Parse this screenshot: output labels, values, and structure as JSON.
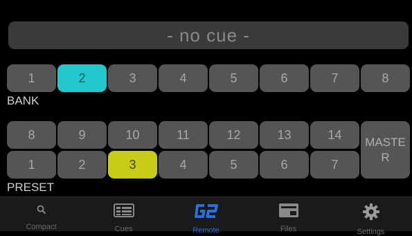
{
  "cue_display": {
    "text": "- no cue -"
  },
  "bank": {
    "label": "BANK",
    "buttons": [
      "1",
      "2",
      "3",
      "4",
      "5",
      "6",
      "7",
      "8"
    ],
    "selected": "2"
  },
  "preset": {
    "label": "PRESET",
    "row1": [
      "8",
      "9",
      "10",
      "11",
      "12",
      "13",
      "14"
    ],
    "row2": [
      "1",
      "2",
      "3",
      "4",
      "5",
      "6",
      "7"
    ],
    "selected": "3",
    "master_label": "MASTER"
  },
  "tabbar": {
    "tabs": [
      {
        "label": "Compact",
        "icon": "search-icon"
      },
      {
        "label": "Cues",
        "icon": "cues-icon"
      },
      {
        "label": "Remote",
        "icon": "g2-logo-icon"
      },
      {
        "label": "Files",
        "icon": "files-icon"
      },
      {
        "label": "Settings",
        "icon": "gear-icon"
      }
    ],
    "active": "Remote"
  },
  "colors": {
    "bank_selected": "#22c8cc",
    "preset_selected": "#c8cc14",
    "active_tab": "#2a6fe0"
  }
}
